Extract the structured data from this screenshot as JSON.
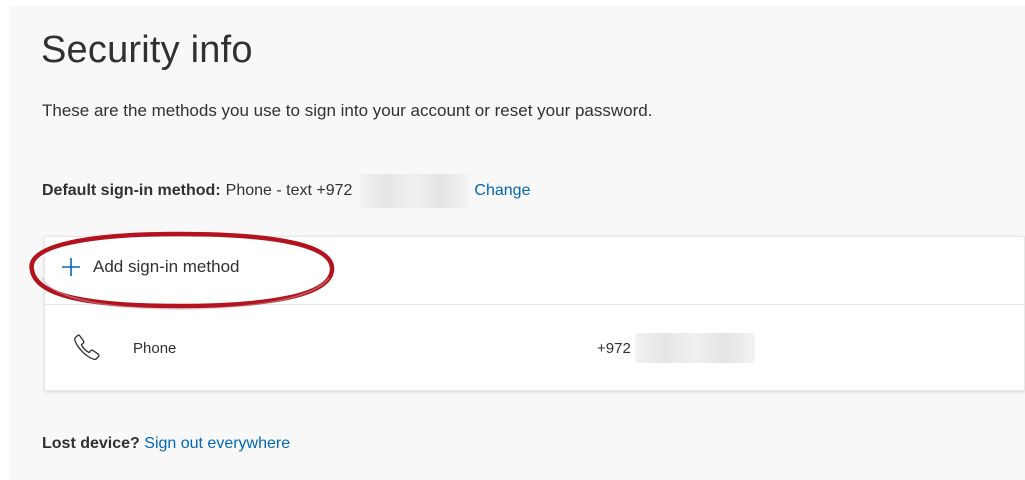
{
  "page": {
    "title": "Security info",
    "description": "These are the methods you use to sign into your account or reset your password."
  },
  "default_method": {
    "label": "Default sign-in method:",
    "value": "Phone - text +972",
    "change_link": "Change"
  },
  "methods_card": {
    "add_label": "Add sign-in method",
    "add_icon": "plus-icon",
    "items": [
      {
        "icon": "phone-icon",
        "type": "Phone",
        "value": "+972"
      }
    ]
  },
  "lost_device": {
    "label": "Lost device?",
    "link": "Sign out everywhere"
  },
  "colors": {
    "link": "#0067b8",
    "annotation": "#b3121e",
    "panel_background": "#f8f8f8"
  }
}
